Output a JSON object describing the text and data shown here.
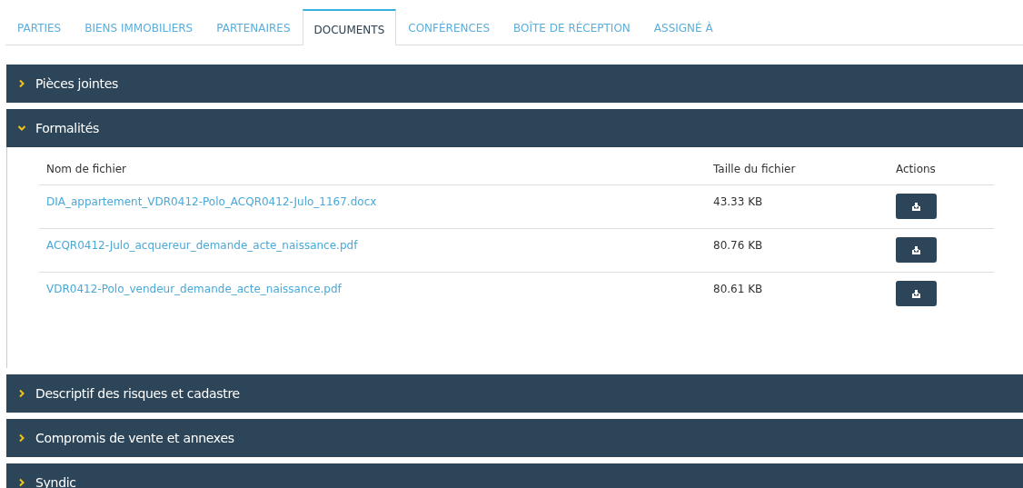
{
  "tabs": [
    {
      "label": "PARTIES",
      "selected": false
    },
    {
      "label": "BIENS IMMOBILIERS",
      "selected": false
    },
    {
      "label": "PARTENAIRES",
      "selected": false
    },
    {
      "label": "DOCUMENTS",
      "selected": true
    },
    {
      "label": "CONFÉRENCES",
      "selected": false
    },
    {
      "label": "BOÎTE DE RÉCEPTION",
      "selected": false
    },
    {
      "label": "ASSIGNÉ À",
      "selected": false
    }
  ],
  "sections": [
    {
      "title": "Pièces jointes",
      "expanded": false
    },
    {
      "title": "Formalités",
      "expanded": true,
      "table": {
        "columns": [
          "Nom de fichier",
          "Taille du fichier",
          "Actions"
        ],
        "rows": [
          {
            "file_name": "DIA_appartement_VDR0412-Polo_ACQR0412-Julo_1167.docx",
            "size": "43.33 KB"
          },
          {
            "file_name": "ACQR0412-Julo_acquereur_demande_acte_naissance.pdf",
            "size": "80.76 KB"
          },
          {
            "file_name": "VDR0412-Polo_vendeur_demande_acte_naissance.pdf",
            "size": "80.61 KB"
          }
        ]
      }
    },
    {
      "title": "Descriptif des risques et cadastre",
      "expanded": false
    },
    {
      "title": "Compromis de vente et annexes",
      "expanded": false
    },
    {
      "title": "Syndic",
      "expanded": false
    }
  ]
}
